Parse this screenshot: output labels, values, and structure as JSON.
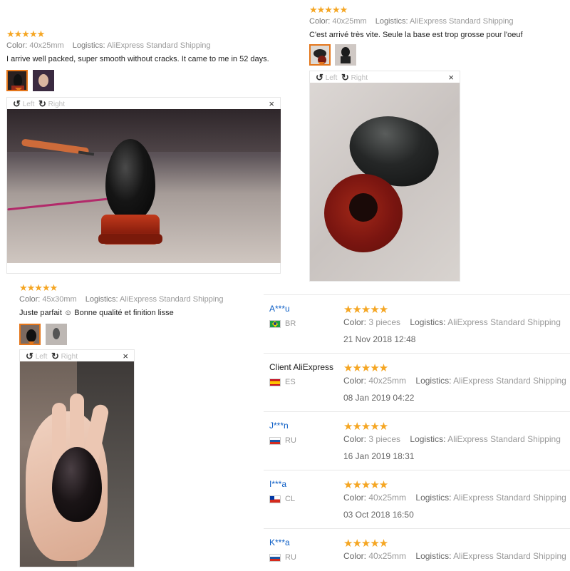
{
  "reviews_top": [
    {
      "stars": "★★★★★",
      "color_label": "Color:",
      "color_value": "40x25mm",
      "logistics_label": "Logistics:",
      "logistics_value": "AliExpress Standard Shipping",
      "text": "I arrive well packed, super smooth without cracks. It came to me in 52 days.",
      "viewer_left": "Left",
      "viewer_right": "Right",
      "close": "×"
    },
    {
      "stars": "★★★★★",
      "color_label": "Color:",
      "color_value": "40x25mm",
      "logistics_label": "Logistics:",
      "logistics_value": "AliExpress Standard Shipping",
      "text": "C'est arrivé très vite. Seule la base est trop grosse pour l'oeuf",
      "viewer_left": "Left",
      "viewer_right": "Right",
      "close": "×"
    },
    {
      "stars": "★★★★★",
      "color_label": "Color:",
      "color_value": "45x30mm",
      "logistics_label": "Logistics:",
      "logistics_value": "AliExpress Standard Shipping",
      "text": "Juste parfait ☺ Bonne qualité et finition lisse",
      "viewer_left": "Left",
      "viewer_right": "Right",
      "close": "×"
    }
  ],
  "review_list": [
    {
      "user": "A***u",
      "country": "BR",
      "stars": "★★★★★",
      "attr_label": "Color:",
      "attr_value": "3 pieces",
      "logistics_label": "Logistics:",
      "logistics_value": "AliExpress Standard Shipping",
      "date": "21 Nov 2018 12:48"
    },
    {
      "user": "Client AliExpress",
      "country": "ES",
      "stars": "★★★★★",
      "attr_label": "Color:",
      "attr_value": "40x25mm",
      "logistics_label": "Logistics:",
      "logistics_value": "AliExpress Standard Shipping",
      "date": "08 Jan 2019 04:22"
    },
    {
      "user": "J***n",
      "country": "RU",
      "stars": "★★★★★",
      "attr_label": "Color:",
      "attr_value": "3 pieces",
      "logistics_label": "Logistics:",
      "logistics_value": "AliExpress Standard Shipping",
      "date": "16 Jan 2019 18:31"
    },
    {
      "user": "I***a",
      "country": "CL",
      "stars": "★★★★★",
      "attr_label": "Color:",
      "attr_value": "40x25mm",
      "logistics_label": "Logistics:",
      "logistics_value": "AliExpress Standard Shipping",
      "date": "03 Oct 2018 16:50"
    },
    {
      "user": "K***a",
      "country": "RU",
      "stars": "★★★★★",
      "attr_label": "Color:",
      "attr_value": "40x25mm",
      "logistics_label": "Logistics:",
      "logistics_value": "AliExpress Standard Shipping",
      "date": ""
    }
  ],
  "colors": {
    "accent_orange": "#e4761b",
    "star": "#f5a623",
    "user_link": "#0e5fc6"
  },
  "icons": {
    "rotate_left": "rotate-left-icon",
    "rotate_right": "rotate-right-icon",
    "close": "close-icon"
  }
}
